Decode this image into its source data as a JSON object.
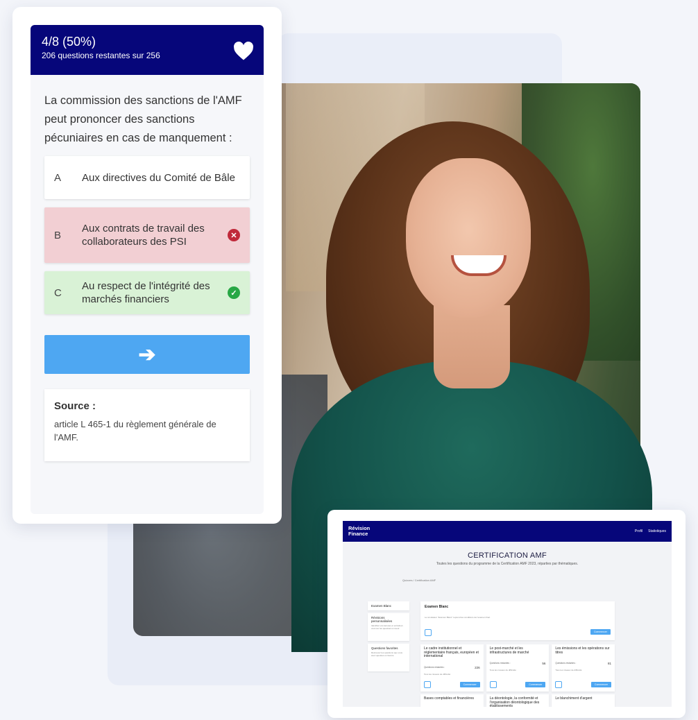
{
  "quiz": {
    "progress": "4/8 (50%)",
    "remaining": "206 questions restantes sur 256",
    "question": "La commission des sanctions de l'AMF peut prononcer des sanctions pécuniaires en cas de manquement :",
    "answers": [
      {
        "letter": "A",
        "text": "Aux directives du Comité de Bâle",
        "state": "neutral"
      },
      {
        "letter": "B",
        "text": "Aux contrats de travail des collaborateurs des PSI",
        "state": "wrong"
      },
      {
        "letter": "C",
        "text": "Au respect de l'intégrité des marchés financiers",
        "state": "correct"
      }
    ],
    "next_label": "➔",
    "source_title": "Source :",
    "source_text": "article L 465-1 du règlement générale de l'AMF."
  },
  "dashboard": {
    "brand_line1": "Révision",
    "brand_line2": "Finance",
    "nav": [
      "Profil",
      "Statistiques"
    ],
    "title": "CERTIFICATION AMF",
    "subtitle": "Toutes les questions du programme de la Certification AMF 2023, réparties par thématiques.",
    "breadcrumb": "Quizzes / Certification AMF",
    "sidebar": [
      {
        "label": "Examen Blanc",
        "sub": ""
      },
      {
        "label": "Révisions personnalisées",
        "sub": "Identifiez vos lacunes et entraînez-vous sur les questions à revoir."
      },
      {
        "label": "Questions favorites",
        "sub": "Retrouvez les questions que vous avez ajoutées en favoris."
      }
    ],
    "exam": {
      "title": "Examen Blanc",
      "text": "Le simulateur \"Examen Blanc\" reprend les conditions de l'examen final.",
      "button": "Commencer"
    },
    "themes": [
      {
        "title": "Le cadre institutionnel et réglementaire français, européen et international",
        "label": "Questions restantes :",
        "count": "226",
        "tip": "Tous les niveaux de difficulté",
        "button": "Commencer"
      },
      {
        "title": "Le post-marché et les infrastructures de marché",
        "label": "Questions restantes :",
        "count": "56",
        "tip": "Tous les niveaux de difficulté",
        "button": "Commencer"
      },
      {
        "title": "Les émissions et les opérations sur titres",
        "label": "Questions restantes :",
        "count": "81",
        "tip": "Tous les niveaux de difficulté",
        "button": "Commencer"
      }
    ],
    "themes_row2": [
      "Bases comptables et financières",
      "La déontologie, la conformité et l'organisation déontologique des établissements",
      "Le blanchiment d'argent"
    ]
  }
}
